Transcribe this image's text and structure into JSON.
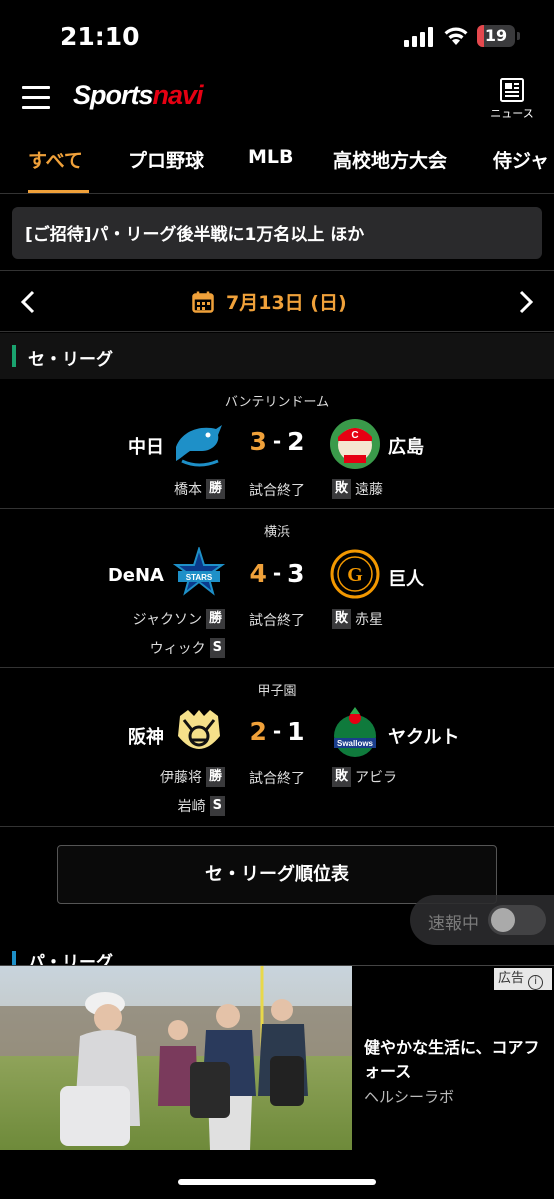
{
  "status_bar": {
    "time": "21:10",
    "battery": "19",
    "battery_fraction": 0.19,
    "battery_color": "#e5484d"
  },
  "header": {
    "logo_part1": "Sports",
    "logo_part2": "navi",
    "news_label": "ニュース"
  },
  "tabs": [
    {
      "label": "すべて",
      "active": true
    },
    {
      "label": "プロ野球"
    },
    {
      "label": "MLB"
    },
    {
      "label": "高校地方大会"
    },
    {
      "label": "侍ジャ"
    }
  ],
  "announcement": "[ご招待]パ・リーグ後半戦に1万名以上 ほか",
  "date_nav": {
    "date": "7月13日 (日)"
  },
  "central": {
    "name": "セ・リーグ",
    "color": "#1aa36f",
    "games": [
      {
        "venue": "バンテリンドーム",
        "home": "中日",
        "home_score": "3",
        "away": "広島",
        "away_score": "2",
        "status": "試合終了",
        "win_pitcher": "橋本",
        "win_badge": "勝",
        "lose_pitcher": "遠藤",
        "lose_badge": "敗"
      },
      {
        "venue": "横浜",
        "home": "DeNA",
        "home_score": "4",
        "away": "巨人",
        "away_score": "3",
        "status": "試合終了",
        "win_pitcher": "ジャクソン",
        "win_badge": "勝",
        "save_pitcher": "ウィック",
        "save_badge": "S",
        "lose_pitcher": "赤星",
        "lose_badge": "敗"
      },
      {
        "venue": "甲子園",
        "home": "阪神",
        "home_score": "2",
        "away": "ヤクルト",
        "away_score": "1",
        "status": "試合終了",
        "win_pitcher": "伊藤将",
        "win_badge": "勝",
        "save_pitcher": "岩崎",
        "save_badge": "S",
        "lose_pitcher": "アビラ",
        "lose_badge": "敗"
      }
    ],
    "score_dash": "-",
    "standings_button": "セ・リーグ順位表"
  },
  "live_toggle": {
    "label": "速報中",
    "on": false
  },
  "pacific": {
    "name": "パ・リーグ",
    "color": "#1e90c8"
  },
  "ad": {
    "badge": "広告",
    "title": "健やかな生活に、コアフォース",
    "sponsor": "ヘルシーラボ"
  },
  "accent_color": "#f0a13a"
}
